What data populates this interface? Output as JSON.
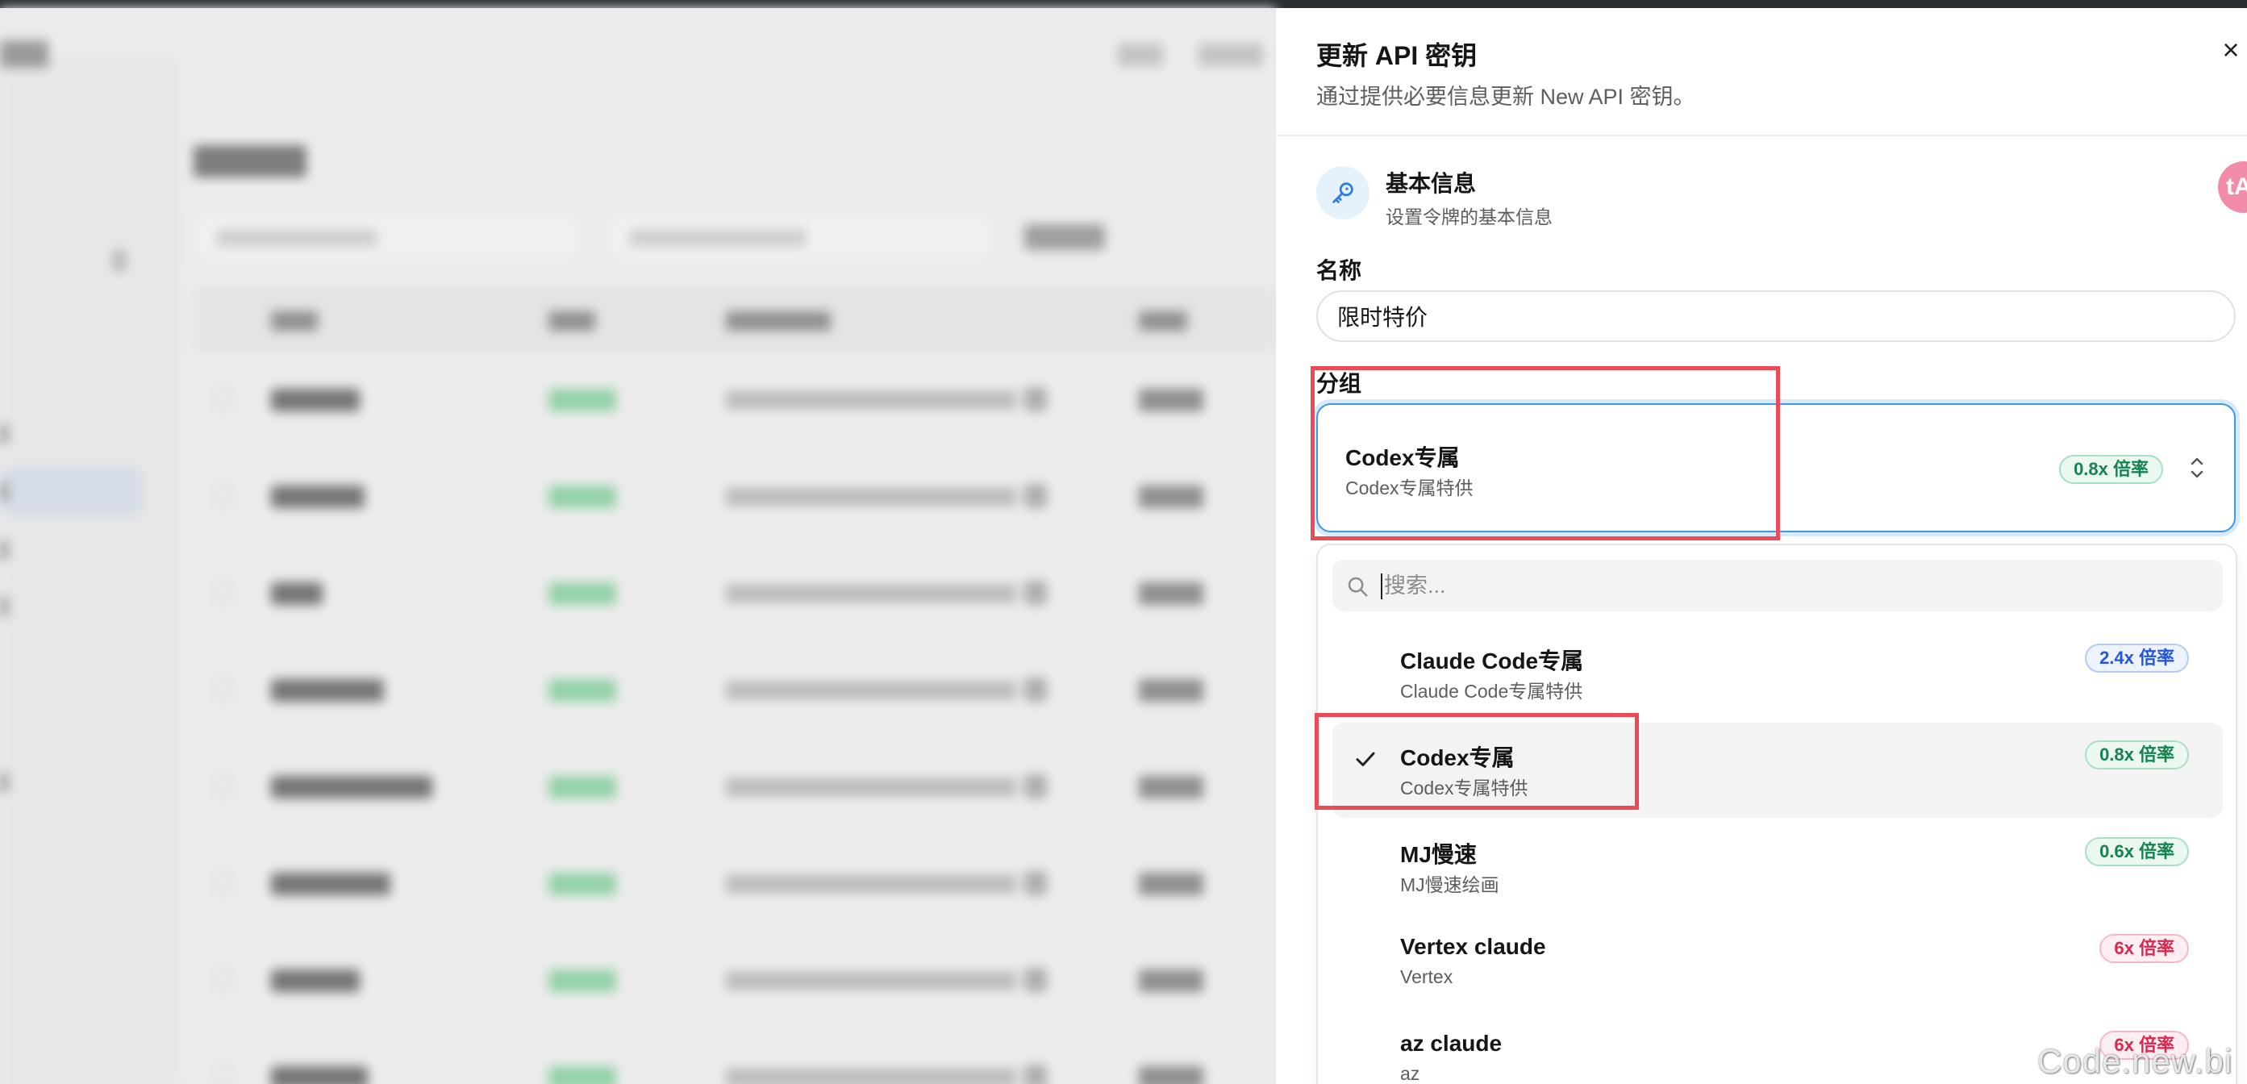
{
  "drawer": {
    "title": "更新 API 密钥",
    "subtitle": "通过提供必要信息更新 New API 密钥。",
    "close_label": "×",
    "section": {
      "title": "基本信息",
      "subtitle": "设置令牌的基本信息",
      "icon": "key-icon",
      "side_badge": "tA"
    },
    "name_field": {
      "label": "名称",
      "value": "限时特价"
    },
    "group_field": {
      "label": "分组",
      "selected": {
        "name": "Codex专属",
        "desc": "Codex专属特供",
        "rate": "0.8x 倍率"
      }
    },
    "dropdown": {
      "search_placeholder": "搜索...",
      "options": [
        {
          "name": "Claude Code专属",
          "desc": "Claude Code专属特供",
          "rate": "2.4x 倍率",
          "rate_color": "#2456d8",
          "selected": false
        },
        {
          "name": "Codex专属",
          "desc": "Codex专属特供",
          "rate": "0.8x 倍率",
          "rate_color": "#13834f",
          "selected": true
        },
        {
          "name": "MJ慢速",
          "desc": "MJ慢速绘画",
          "rate": "0.6x 倍率",
          "rate_color": "#13834f",
          "selected": false
        },
        {
          "name": "Vertex claude",
          "desc": "Vertex",
          "rate": "6x 倍率",
          "rate_color": "#d6294f",
          "selected": false
        },
        {
          "name": "az claude",
          "desc": "az",
          "rate": "6x 倍率",
          "rate_color": "#d6294f",
          "selected": false
        }
      ]
    }
  },
  "colors": {
    "accent": "#3f95e6",
    "annotation": "#ec4b55",
    "rate_green": "#13834f",
    "rate_blue": "#2456d8",
    "rate_red": "#d6294f"
  },
  "watermark": "Code.new.bi"
}
